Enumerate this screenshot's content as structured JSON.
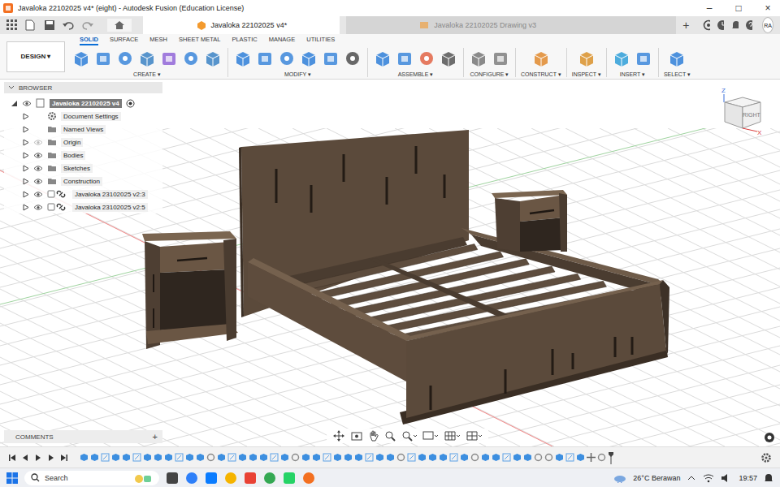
{
  "window": {
    "title": "Javaloka 22102025 v4* (eight) - Autodesk Fusion (Education License)",
    "controls": [
      "–",
      "□",
      "×"
    ]
  },
  "documents": [
    {
      "label": "Javaloka 22102025 v4*",
      "selected": true
    },
    {
      "label": "Javaloka 22102025 Drawing v3",
      "selected": false
    }
  ],
  "new_tab": "+",
  "user": {
    "initials": "RA"
  },
  "ribbon": {
    "workspace": "DESIGN ▾",
    "tabs": [
      {
        "label": "SOLID",
        "selected": true
      },
      {
        "label": "SURFACE",
        "selected": false
      },
      {
        "label": "MESH",
        "selected": false
      },
      {
        "label": "SHEET METAL",
        "selected": false
      },
      {
        "label": "PLASTIC",
        "selected": false
      },
      {
        "label": "MANAGE",
        "selected": false
      },
      {
        "label": "UTILITIES",
        "selected": false
      }
    ],
    "groups": [
      "CREATE ▾",
      "MODIFY ▾",
      "ASSEMBLE ▾",
      "CONFIGURE ▾",
      "CONSTRUCT ▾",
      "INSPECT ▾",
      "INSERT ▾",
      "SELECT ▾"
    ]
  },
  "browser": {
    "title": "BROWSER",
    "items": [
      {
        "name": "Javaloka 22102025 v4",
        "kind": "root",
        "depth": 0,
        "expanded": true,
        "eye": "shown"
      },
      {
        "name": "Document Settings",
        "kind": "settings",
        "depth": 1,
        "expanded": false,
        "eye": "none"
      },
      {
        "name": "Named Views",
        "kind": "folder",
        "depth": 1,
        "expanded": false,
        "eye": "none"
      },
      {
        "name": "Origin",
        "kind": "folder",
        "depth": 1,
        "expanded": false,
        "eye": "hidden"
      },
      {
        "name": "Bodies",
        "kind": "folder",
        "depth": 1,
        "expanded": false,
        "eye": "shown"
      },
      {
        "name": "Sketches",
        "kind": "folder",
        "depth": 1,
        "expanded": false,
        "eye": "shown"
      },
      {
        "name": "Construction",
        "kind": "folder",
        "depth": 1,
        "expanded": false,
        "eye": "shown"
      },
      {
        "name": "Javaloka 23102025 v2:3",
        "kind": "link",
        "depth": 1,
        "expanded": false,
        "eye": "shown"
      },
      {
        "name": "Javaloka 23102025 v2:5",
        "kind": "link",
        "depth": 1,
        "expanded": false,
        "eye": "shown"
      }
    ]
  },
  "viewcube": {
    "up": "Z",
    "face": "RIGHT",
    "axis": "X"
  },
  "comments": {
    "label": "COMMENTS",
    "add": "+"
  },
  "timeline": {
    "features": [
      "body",
      "body",
      "sketch",
      "body",
      "body",
      "sketch",
      "body",
      "body",
      "body",
      "sketch",
      "body",
      "body",
      "joint",
      "body",
      "sketch",
      "body",
      "body",
      "body",
      "sketch",
      "body",
      "joint",
      "body",
      "body",
      "sketch",
      "body",
      "body",
      "body",
      "sketch",
      "body",
      "body",
      "joint",
      "sketch",
      "body",
      "body",
      "body",
      "sketch",
      "body",
      "joint",
      "body",
      "body",
      "sketch",
      "body",
      "body",
      "joint",
      "joint",
      "body",
      "sketch",
      "body",
      "move",
      "joint"
    ]
  },
  "taskbar": {
    "search": "Search",
    "weather": "26°C Berawan",
    "time": "19:57"
  }
}
